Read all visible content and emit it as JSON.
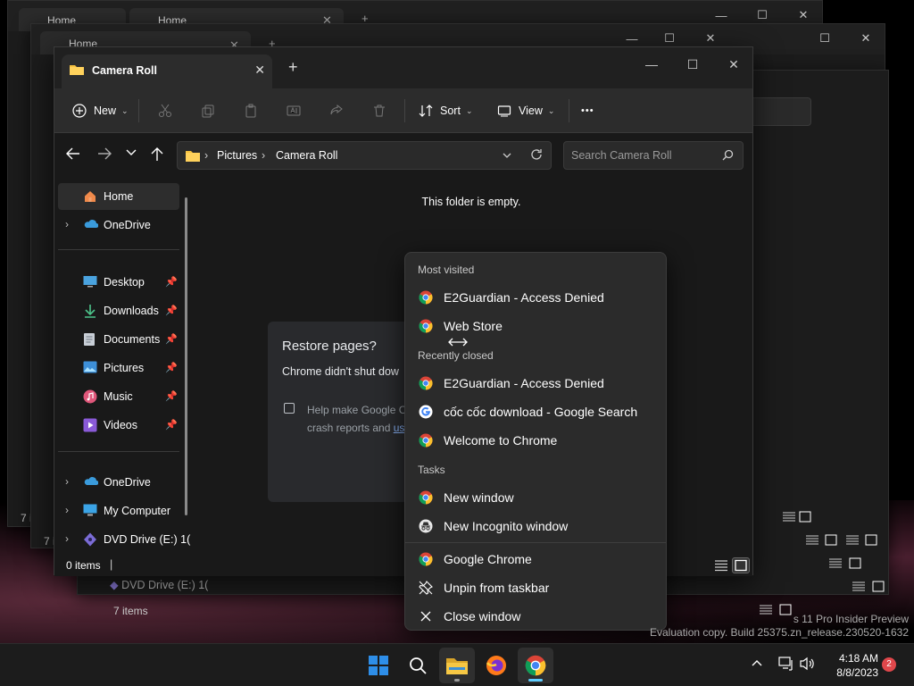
{
  "background_windows": {
    "tab_label": "Home",
    "status_label": "7 items",
    "dvd_label": "DVD Drive (E:) 1("
  },
  "explorer": {
    "tab_title": "Camera Roll",
    "new_tab_glyph": "+",
    "toolbar": {
      "new_label": "New",
      "sort_label": "Sort",
      "view_label": "View",
      "more_glyph": "•••"
    },
    "breadcrumb": [
      "Pictures",
      "Camera Roll"
    ],
    "search_placeholder": "Search Camera Roll",
    "nav": {
      "home": "Home",
      "onedrive_top": "OneDrive",
      "quick_access": [
        "Desktop",
        "Downloads",
        "Documents",
        "Pictures",
        "Music",
        "Videos"
      ],
      "onedrive_bottom": "OneDrive",
      "my_computer": "My Computer",
      "dvd": "DVD Drive (E:) 1("
    },
    "empty_message": "This folder is empty.",
    "status_text": "0 items"
  },
  "restore_dialog": {
    "title": "Restore pages?",
    "body": "Chrome didn't shut dow",
    "help_line1": "Help make Google C",
    "help_line2": "crash reports and ",
    "help_link": "us"
  },
  "jumplist": {
    "most_visited_header": "Most visited",
    "most_visited": [
      "E2Guardian - Access Denied",
      "Web Store"
    ],
    "recently_closed_header": "Recently closed",
    "recently_closed": [
      "E2Guardian - Access Denied",
      "cốc cốc download - Google Search",
      "Welcome to Chrome"
    ],
    "tasks_header": "Tasks",
    "tasks": [
      "New window",
      "New Incognito window"
    ],
    "app_actions": [
      "Google Chrome",
      "Unpin from taskbar",
      "Close window"
    ]
  },
  "watermark": {
    "line1": "s 11 Pro Insider Preview",
    "line2": "Evaluation copy. Build 25375.zn_release.230520-1632"
  },
  "taskbar": {
    "time": "4:18 AM",
    "date": "8/8/2023",
    "notification_count": "2"
  },
  "colors": {
    "folder_yellow": "#f4c03e",
    "onedrive_blue": "#3a9bdc",
    "accent": "#60cdff",
    "badge_red": "#e0474b"
  }
}
